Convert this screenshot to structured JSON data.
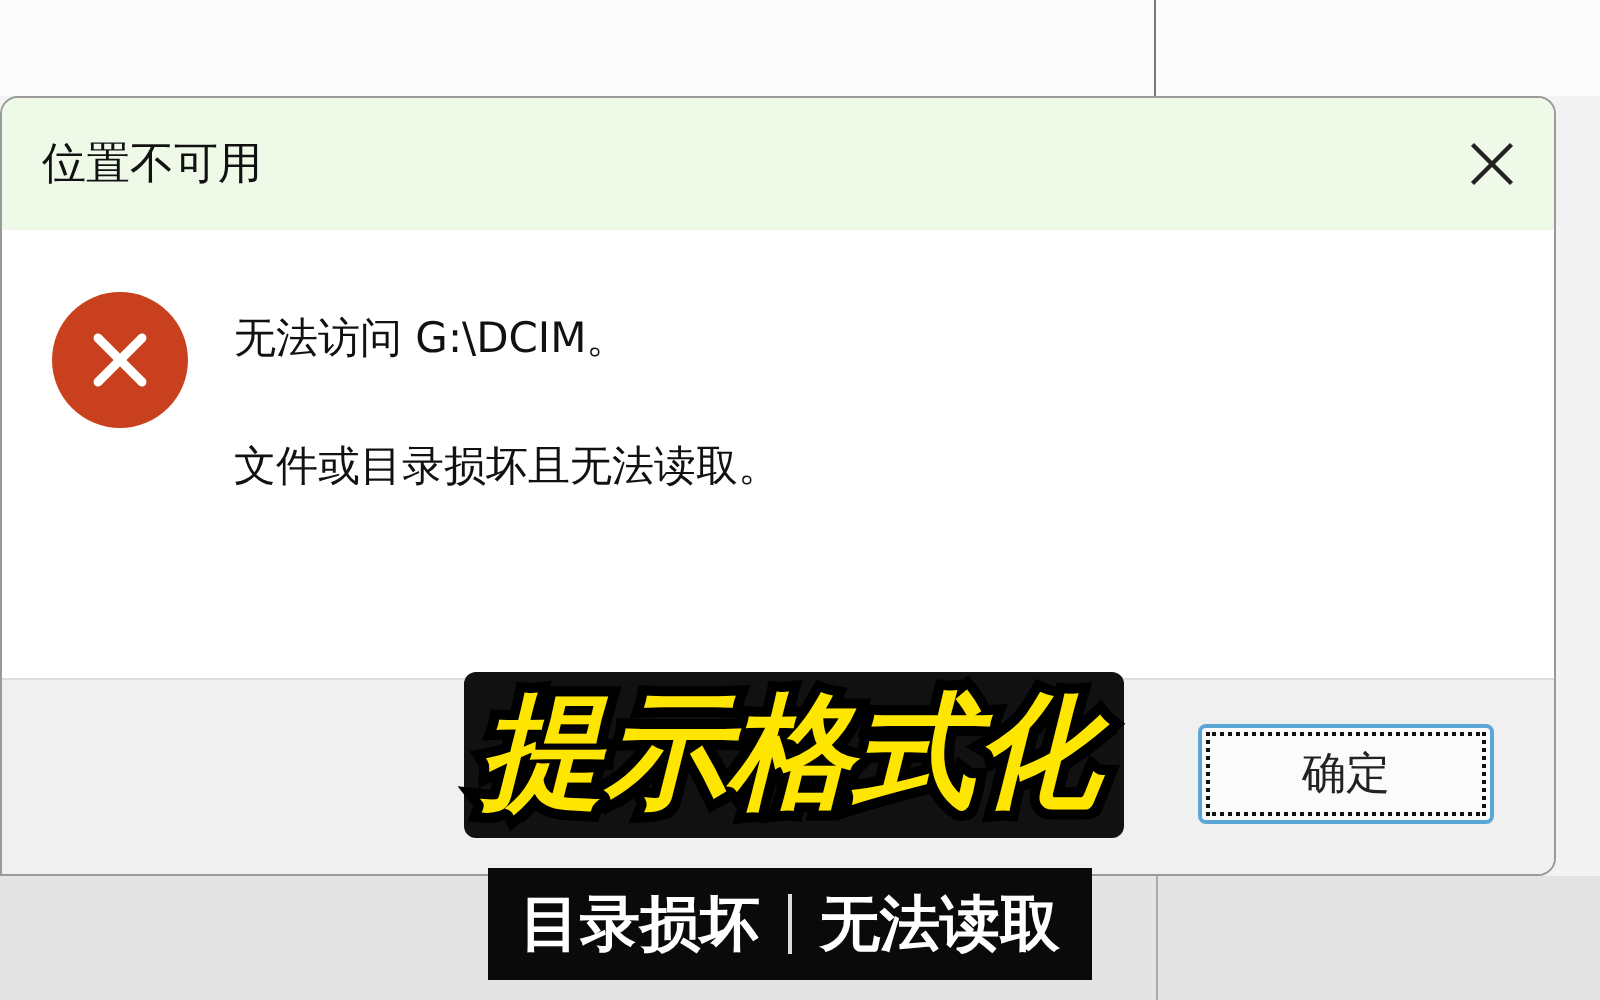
{
  "dialog": {
    "title": "位置不可用",
    "messages": [
      "无法访问 G:\\DCIM。",
      "文件或目录损坏且无法读取。"
    ],
    "button": {
      "label": "确定",
      "focused": true
    }
  },
  "captions": [
    {
      "kind": "headline",
      "text": "提示格式化"
    },
    {
      "kind": "banner",
      "parts": [
        "目录损坏",
        "无法读取"
      ]
    }
  ]
}
